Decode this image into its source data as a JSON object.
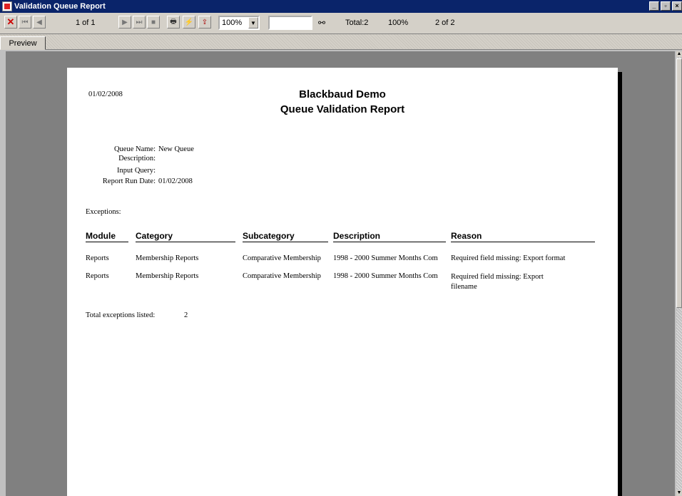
{
  "window": {
    "title": "Validation Queue Report"
  },
  "toolbar": {
    "page_of": "1 of 1",
    "zoom": "100%",
    "search_value": "",
    "total": "Total:2",
    "percent": "100%",
    "count_of": "2 of 2"
  },
  "tabs": [
    {
      "label": "Preview"
    }
  ],
  "report": {
    "date": "01/02/2008",
    "org": "Blackbaud Demo",
    "title": "Queue Validation Report",
    "fields": [
      {
        "label": "Queue Name:",
        "value": "New Queue"
      },
      {
        "label": "Description:",
        "value": ""
      },
      {
        "label": "Input Query:",
        "value": ""
      },
      {
        "label": "Report Run Date:",
        "value": "01/02/2008"
      }
    ],
    "exceptions_label": "Exceptions:",
    "columns": [
      "Module",
      "Category",
      "Subcategory",
      "Description",
      "Reason"
    ],
    "rows": [
      [
        "Reports",
        "Membership Reports",
        "Comparative Membership",
        "1998 - 2000 Summer Months Com",
        "Required field missing: Export format"
      ],
      [
        "Reports",
        "Membership Reports",
        "Comparative Membership",
        "1998 - 2000 Summer Months Com",
        "Required field missing: Export filename"
      ]
    ],
    "total_label": "Total exceptions listed:",
    "total_value": "2"
  },
  "icons": [
    "close-icon",
    "first-page-icon",
    "prev-page-icon",
    "next-page-icon",
    "last-page-icon",
    "stop-icon",
    "print-icon",
    "lightning-icon",
    "export-icon",
    "binoculars-icon"
  ],
  "colors": {
    "titlebar": "#0a246a",
    "workspace": "#808080",
    "page": "#ffffff"
  }
}
